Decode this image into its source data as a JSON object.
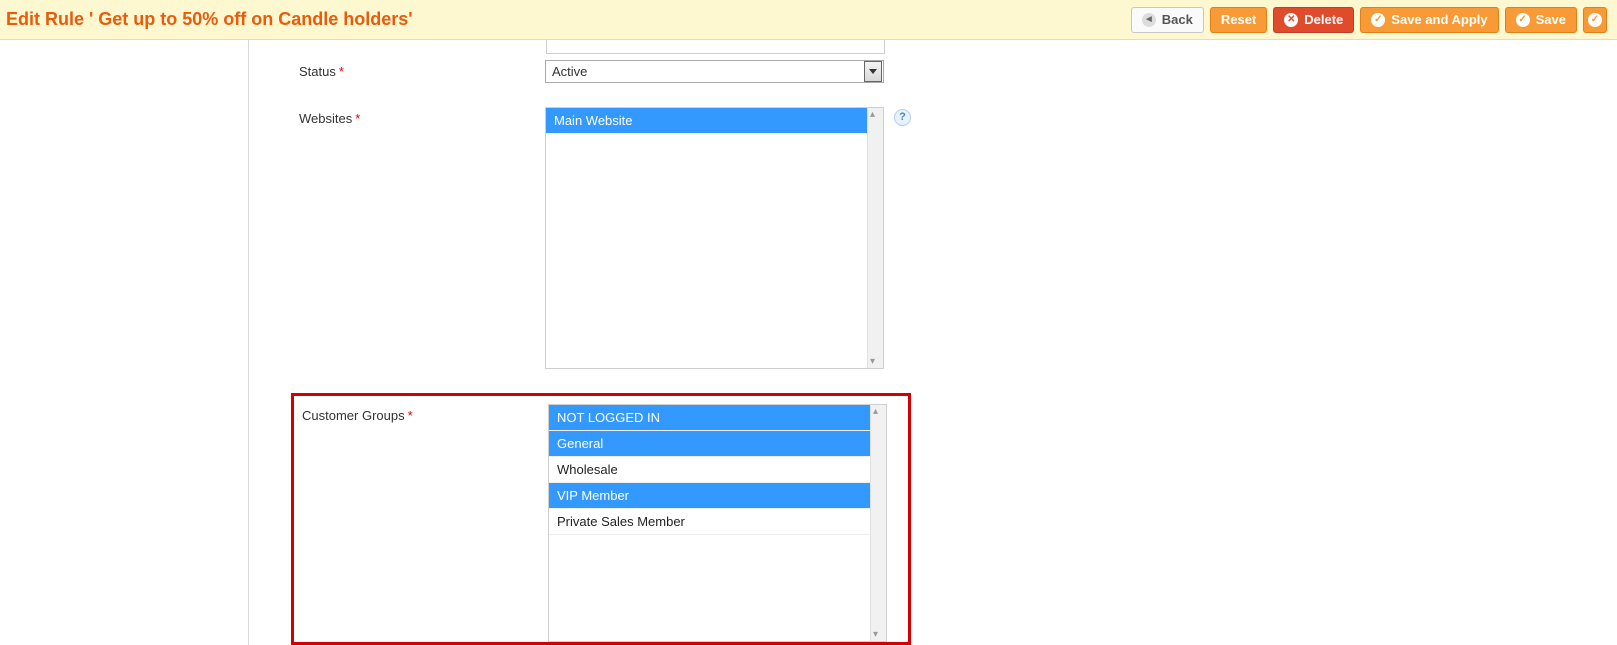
{
  "header": {
    "title": "Edit Rule ' Get up to 50% off on Candle holders'",
    "buttons": {
      "back": "Back",
      "reset": "Reset",
      "delete": "Delete",
      "save_apply": "Save and Apply",
      "save": "Save"
    }
  },
  "form": {
    "status": {
      "label": "Status",
      "required": "*",
      "value": "Active"
    },
    "websites": {
      "label": "Websites",
      "required": "*",
      "options": [
        {
          "text": "Main Website",
          "selected": true
        }
      ]
    },
    "customer_groups": {
      "label": "Customer Groups",
      "required": "*",
      "options": [
        {
          "text": "NOT LOGGED IN",
          "selected": true
        },
        {
          "text": "General",
          "selected": true
        },
        {
          "text": "Wholesale",
          "selected": false
        },
        {
          "text": "VIP Member",
          "selected": true
        },
        {
          "text": "Private Sales Member",
          "selected": false
        }
      ]
    }
  },
  "help_icon_glyph": "?"
}
